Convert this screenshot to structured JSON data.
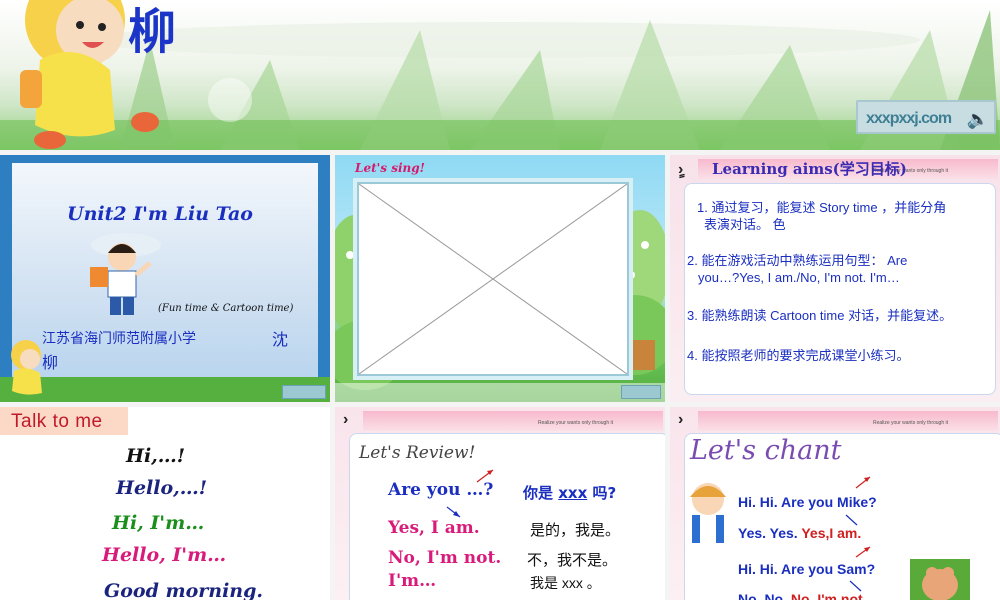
{
  "banner": {
    "title_char": "柳",
    "logo_text": "xxxpxxj.com"
  },
  "panel1": {
    "title": "Unit2 I'm Liu Tao",
    "subtitle": "(Fun time & Cartoon time)",
    "school": "江苏省海门师范附属小学",
    "teacher_part1": "沈",
    "teacher_part2": "柳"
  },
  "panel2": {
    "label": "Let's sing!"
  },
  "panel3": {
    "title": "Learning aims(学习目标)",
    "bar_text": "Realize your wants only through it",
    "aims": [
      {
        "line1": "1.  通过复习，能复述 Story time ，并能分角",
        "line2": "表演对话。                    色"
      },
      {
        "line1": "2.  能在游戏活动中熟练运用句型：  Are",
        "line2": "you…?Yes, I am./No, I'm not. I'm…"
      },
      {
        "line1": "3.  能熟练朗读 Cartoon time 对话，并能复述。",
        "line2": ""
      },
      {
        "line1": "4.  能按照老师的要求完成课堂小练习。",
        "line2": ""
      }
    ]
  },
  "panel4": {
    "heading": "Talk to me",
    "lines": [
      "Hi,…!",
      "Hello,…!",
      "Hi, I'm…",
      "Hello, I'm…",
      "Good morning."
    ],
    "colors": {
      "black": "#111111",
      "navy": "#1a237e",
      "green": "#1b8f1b",
      "pink": "#d81b7a"
    }
  },
  "panel5": {
    "title": "Let's Review!",
    "bar_text": "Realize your wants only through it",
    "q_en_prefix": "Are you",
    "q_en_suffix": "…?",
    "q_cn_prefix": "你是",
    "q_cn_blank": "xxx",
    "q_cn_suffix": "吗?",
    "yes_en": "Yes, I am.",
    "yes_cn": "是的，我是。",
    "no_en": "No, I'm not.",
    "no_cn": "不，我不是。",
    "im_en": "I'm…",
    "im_cn": "我是 xxx 。"
  },
  "panel6": {
    "title": "Let's chant",
    "bar_text": "Realize your wants only through it",
    "line1": "Hi. Hi. Are you Mike?",
    "line2_a": "Yes. Yes.",
    "line2_b": "Yes,I am.",
    "line3": "Hi. Hi. Are you Sam?",
    "line4_a": "No. No.",
    "line4_b": "No, I'm not."
  }
}
